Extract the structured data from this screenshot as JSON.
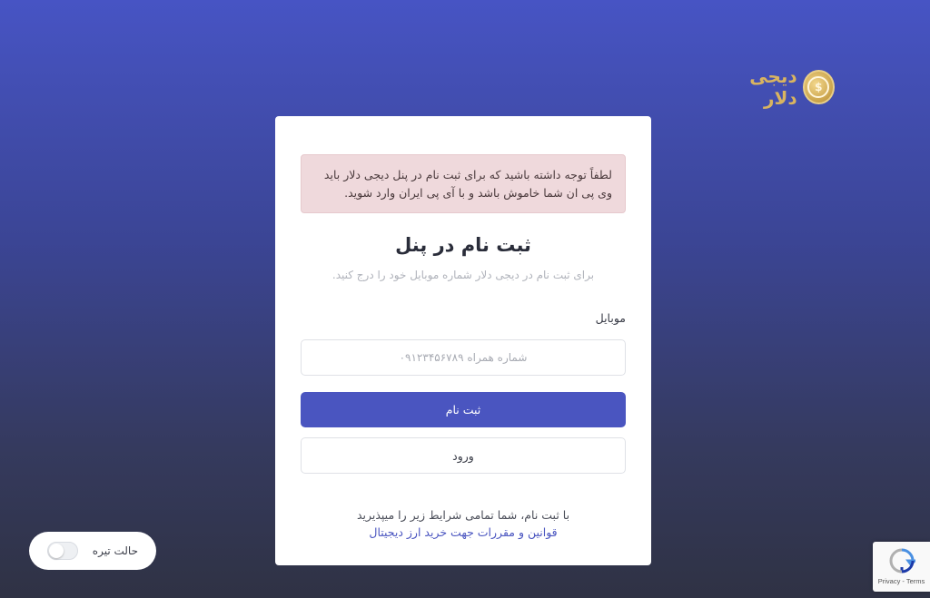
{
  "brand": {
    "name": "دیجی دلار",
    "coin_glyph": "$"
  },
  "alert": {
    "text": "لطفاً توجه داشته باشید که برای ثبت نام در پنل دیجی دلار باید وی پی ان شما خاموش باشد و با آی پی ایران وارد شوید."
  },
  "form": {
    "title": "ثبت نام در پنل",
    "subtitle": "برای ثبت نام در دیجی دلار شماره موبایل خود را درج کنید.",
    "mobile_label": "موبایل",
    "mobile_placeholder": "شماره همراه ۰۹۱۲۳۴۵۶۷۸۹",
    "mobile_value": "",
    "register_button": "ثبت نام",
    "login_button": "ورود",
    "terms_text": "با ثبت نام، شما تمامی شرایط زیر را میپذیرید",
    "terms_link": "قوانین و مقررات جهت خرید ارز دیجیتال"
  },
  "dark_mode": {
    "label": "حالت تیره",
    "enabled": false
  },
  "recaptcha": {
    "text": "Privacy - Terms"
  },
  "colors": {
    "primary": "#4a55c0",
    "alert_bg": "#efd9dc",
    "brand_gold": "#d9b460"
  }
}
